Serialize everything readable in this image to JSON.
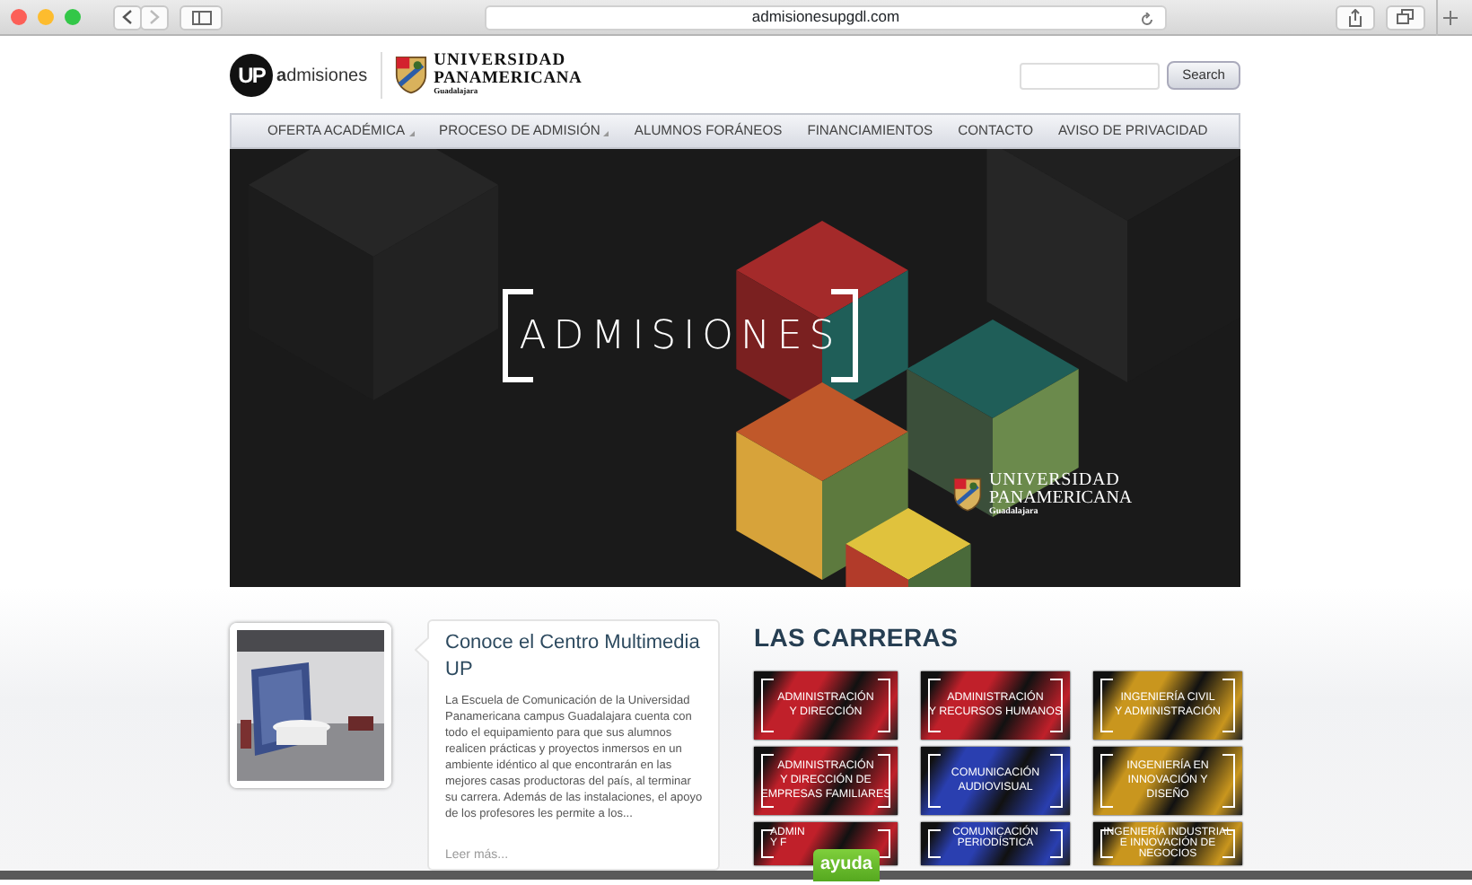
{
  "browser": {
    "url": "admisionesupgdl.com"
  },
  "header": {
    "logo_mark": "UP",
    "logo_text": "**a**dmisiones",
    "university": [
      "UNIVERSIDAD",
      "PANAMERICANA",
      "Guadalajara"
    ],
    "search": {
      "button": "Search"
    }
  },
  "nav": [
    {
      "label": "OFERTA ACADÉMICA",
      "has_submenu": true
    },
    {
      "label": "PROCESO DE ADMISIÓN",
      "has_submenu": true
    },
    {
      "label": "ALUMNOS FORÁNEOS",
      "has_submenu": false
    },
    {
      "label": "FINANCIAMIENTOS",
      "has_submenu": false
    },
    {
      "label": "CONTACTO",
      "has_submenu": false
    },
    {
      "label": "AVISO DE PRIVACIDAD",
      "has_submenu": false
    }
  ],
  "banner": {
    "title": "ADMISIONES",
    "logo": [
      "UNIVERSIDAD",
      "PANAMERICANA",
      "Guadalajara"
    ]
  },
  "feature": {
    "title": "Conoce el Centro Multimedia UP",
    "body": "La Escuela de Comunicación de la Universidad Panamericana campus Guadalajara cuenta con todo el equipamiento para que sus alumnos realicen prácticas y proyectos inmersos en un ambiente idéntico al que encontrarán en las mejores casas productoras del país, al terminar su carrera. Además de las instalaciones, el apoyo de los profesores les permite a los...",
    "link": "Leer más..."
  },
  "careers": {
    "heading": "LAS CARRERAS",
    "tiles": [
      {
        "lines": [
          "ADMINISTRACIÓN",
          "Y DIRECCIÓN"
        ],
        "color": "#c0202a"
      },
      {
        "lines": [
          "ADMINISTRACIÓN",
          "Y RECURSOS HUMANOS"
        ],
        "color": "#c0202a"
      },
      {
        "lines": [
          "INGENIERÍA CIVIL",
          "Y ADMINISTRACIÓN"
        ],
        "color": "#c9961e"
      },
      {
        "lines": [
          "ADMINISTRACIÓN",
          "Y DIRECCIÓN DE",
          "EMPRESAS FAMILIARES"
        ],
        "color": "#c0202a"
      },
      {
        "lines": [
          "COMUNICACIÓN",
          "AUDIOVISUAL"
        ],
        "color": "#2a3fb0"
      },
      {
        "lines": [
          "INGENIERÍA EN",
          "INNOVACIÓN Y",
          "DISEÑO"
        ],
        "color": "#c9961e"
      },
      {
        "lines": [
          "ADMIN",
          "Y F"
        ],
        "color": "#c0202a"
      },
      {
        "lines": [
          "COMUNICACIÓN",
          "PERIODÍSTICA"
        ],
        "color": "#2a3fb0"
      },
      {
        "lines": [
          "INGENIERÍA INDUSTRIAL",
          "E INNOVACIÓN DE",
          "NEGOCIOS"
        ],
        "color": "#c9961e"
      }
    ]
  },
  "help": {
    "label": "ayuda"
  }
}
